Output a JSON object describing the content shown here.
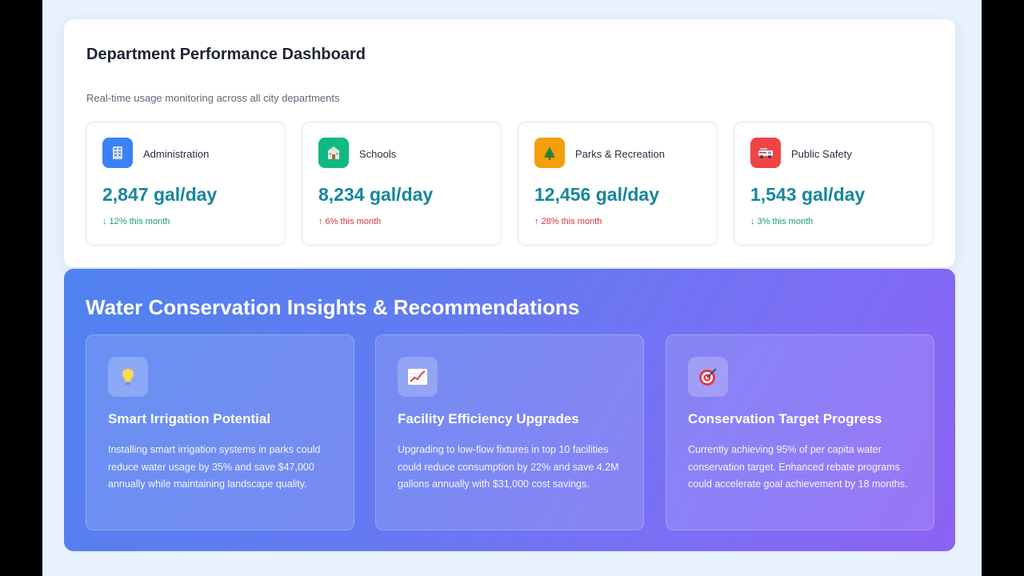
{
  "dashboard": {
    "title": "Department Performance Dashboard",
    "subtitle": "Real-time usage monitoring across all city departments",
    "departments": [
      {
        "name": "Administration",
        "icon": "office-building-icon",
        "icon_color": "#3b82f6",
        "value": "2,847 gal/day",
        "change": "↓ 12% this month",
        "trend": "down"
      },
      {
        "name": "Schools",
        "icon": "school-icon",
        "icon_color": "#10b981",
        "value": "8,234 gal/day",
        "change": "↑ 6% this month",
        "trend": "up"
      },
      {
        "name": "Parks & Recreation",
        "icon": "tree-icon",
        "icon_color": "#f59e0b",
        "value": "12,456 gal/day",
        "change": "↑ 28% this month",
        "trend": "up"
      },
      {
        "name": "Public Safety",
        "icon": "fire-truck-icon",
        "icon_color": "#ef4444",
        "value": "1,543 gal/day",
        "change": "↓ 3% this month",
        "trend": "down"
      }
    ]
  },
  "insights": {
    "title": "Water Conservation Insights & Recommendations",
    "cards": [
      {
        "icon": "lightbulb-icon",
        "title": "Smart Irrigation Potential",
        "text": "Installing smart irrigation systems in parks could reduce water usage by 35% and save $47,000 annually while maintaining landscape quality."
      },
      {
        "icon": "chart-increasing-icon",
        "title": "Facility Efficiency Upgrades",
        "text": "Upgrading to low-flow fixtures in top 10 facilities could reduce consumption by 22% and save 4.2M gallons annually with $31,000 cost savings."
      },
      {
        "icon": "target-icon",
        "title": "Conservation Target Progress",
        "text": "Currently achieving 95% of per capita water conservation target. Enhanced rebate programs could accelerate goal achievement by 18 months."
      }
    ]
  },
  "colors": {
    "value_text": "#16869c",
    "trend_down": "#1d9e67",
    "trend_up": "#d9363e",
    "gradient_start": "#4f82ef",
    "gradient_end": "#8c61f3"
  }
}
